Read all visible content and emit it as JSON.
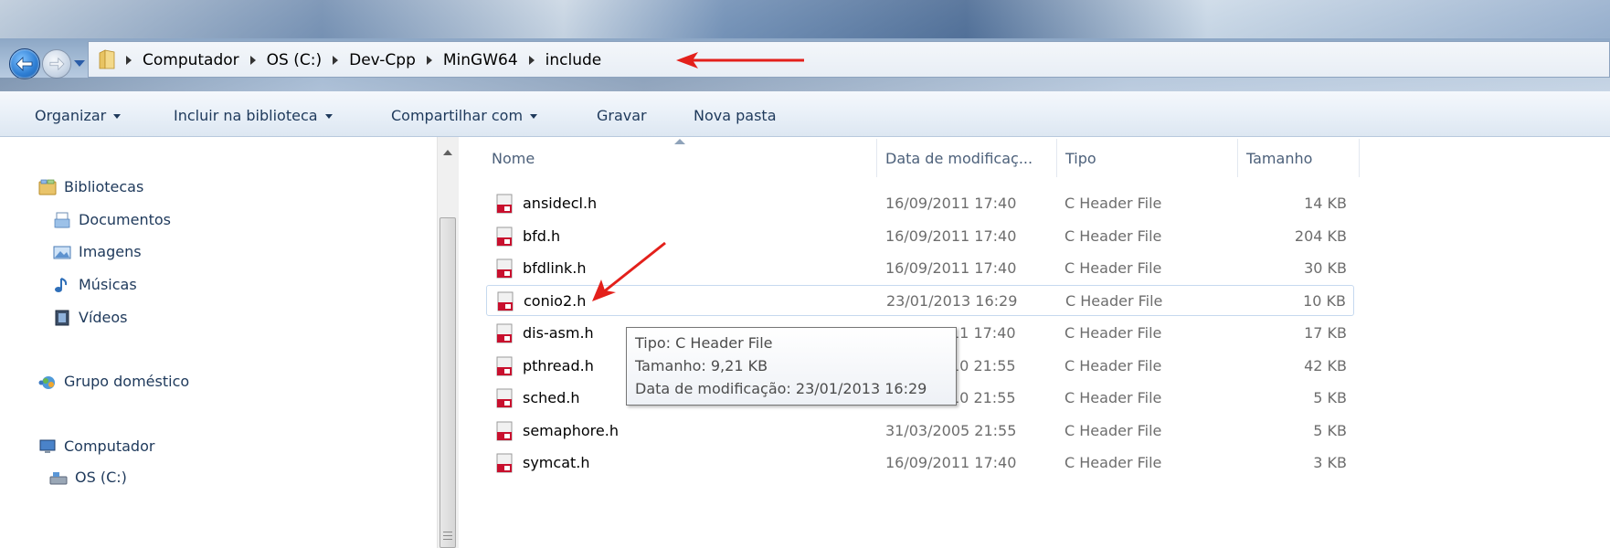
{
  "address": {
    "crumbs": [
      "Computador",
      "OS (C:)",
      "Dev-Cpp",
      "MinGW64",
      "include"
    ]
  },
  "toolbar": {
    "organize": "Organizar",
    "include_library": "Incluir na biblioteca",
    "share_with": "Compartilhar com",
    "burn": "Gravar",
    "new_folder": "Nova pasta"
  },
  "nav": {
    "libraries": "Bibliotecas",
    "documents": "Documentos",
    "images": "Imagens",
    "music": "Músicas",
    "videos": "Vídeos",
    "homegroup": "Grupo doméstico",
    "computer": "Computador",
    "drive_c": "OS (C:)"
  },
  "columns": {
    "name": "Nome",
    "date": "Data de modificaç...",
    "type": "Tipo",
    "size": "Tamanho"
  },
  "files": [
    {
      "name": "ansidecl.h",
      "date": "16/09/2011 17:40",
      "type": "C Header File",
      "size": "14 KB"
    },
    {
      "name": "bfd.h",
      "date": "16/09/2011 17:40",
      "type": "C Header File",
      "size": "204 KB"
    },
    {
      "name": "bfdlink.h",
      "date": "16/09/2011 17:40",
      "type": "C Header File",
      "size": "30 KB"
    },
    {
      "name": "conio2.h",
      "date": "23/01/2013 16:29",
      "type": "C Header File",
      "size": "10 KB"
    },
    {
      "name": "dis-asm.h",
      "date": "11 17:40",
      "type": "C Header File",
      "size": "17 KB"
    },
    {
      "name": "pthread.h",
      "date": "10 21:55",
      "type": "C Header File",
      "size": "42 KB"
    },
    {
      "name": "sched.h",
      "date": "10 21:55",
      "type": "C Header File",
      "size": "5 KB"
    },
    {
      "name": "semaphore.h",
      "date": "31/03/2005 21:55",
      "type": "C Header File",
      "size": "5 KB"
    },
    {
      "name": "symcat.h",
      "date": "16/09/2011 17:40",
      "type": "C Header File",
      "size": "3 KB"
    }
  ],
  "tooltip": {
    "type": "Tipo: C Header File",
    "size": "Tamanho: 9,21 KB",
    "modified": "Data de modificação: 23/01/2013 16:29"
  },
  "colors": {
    "annotation_arrow": "#e3201b",
    "hover_border": "#c6d9ef",
    "header_file_icon": "#c8102e"
  }
}
